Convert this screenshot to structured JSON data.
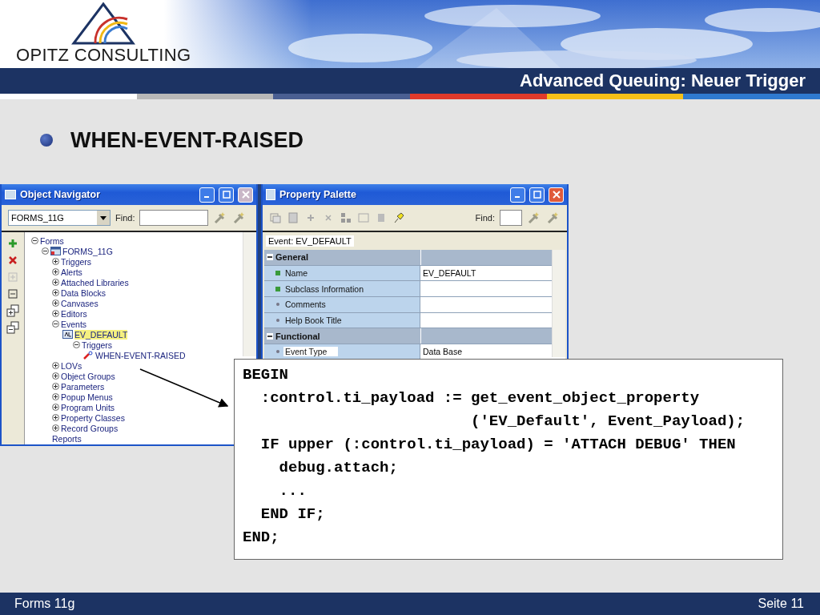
{
  "header": {
    "logo": "OPITZ CONSULTING",
    "title": "Advanced Queuing: Neuer Trigger"
  },
  "bullet": "WHEN-EVENT-RAISED",
  "navigator": {
    "title": "Object Navigator",
    "close_disabled": true,
    "module": "FORMS_11G",
    "find_label": "Find:",
    "tree": [
      {
        "label": "Forms",
        "expanded": true,
        "selected": false,
        "children": [
          {
            "label": "FORMS_11G",
            "kind": "form",
            "expanded": true,
            "selected": false,
            "children": [
              {
                "label": "Triggers",
                "expanded": false,
                "selected": false
              },
              {
                "label": "Alerts",
                "expanded": false,
                "selected": false
              },
              {
                "label": "Attached Libraries",
                "expanded": false,
                "selected": false
              },
              {
                "label": "Data Blocks",
                "expanded": false,
                "selected": false
              },
              {
                "label": "Canvases",
                "expanded": false,
                "selected": false
              },
              {
                "label": "Editors",
                "expanded": false,
                "selected": false
              },
              {
                "label": "Events",
                "expanded": true,
                "selected": false,
                "children": [
                  {
                    "label": "EV_DEFAULT",
                    "kind": "event",
                    "selected": true,
                    "children": [
                      {
                        "label": "Triggers",
                        "expanded": true,
                        "selected": false,
                        "children": [
                          {
                            "label": "WHEN-EVENT-RAISED",
                            "kind": "trigger",
                            "selected": false
                          }
                        ]
                      }
                    ]
                  }
                ]
              },
              {
                "label": "LOVs",
                "expanded": false,
                "selected": false
              },
              {
                "label": "Object Groups",
                "expanded": false,
                "selected": false
              },
              {
                "label": "Parameters",
                "expanded": false,
                "selected": false
              },
              {
                "label": "Popup Menus",
                "expanded": false,
                "selected": false
              },
              {
                "label": "Program Units",
                "expanded": false,
                "selected": false
              },
              {
                "label": "Property Classes",
                "expanded": false,
                "selected": false
              },
              {
                "label": "Record Groups",
                "expanded": false,
                "selected": false
              },
              {
                "label": "Reports",
                "selected": false
              }
            ]
          }
        ]
      }
    ]
  },
  "palette": {
    "title": "Property Palette",
    "close_disabled": false,
    "find_label": "Find:",
    "context": "Event: EV_DEFAULT",
    "rows": [
      {
        "kind": "section",
        "name": "General",
        "expanded": true
      },
      {
        "kind": "property",
        "name": "Name",
        "value": "EV_DEFAULT",
        "inherited": true,
        "selected": false
      },
      {
        "kind": "property",
        "name": "Subclass Information",
        "inherited": true,
        "selected": false
      },
      {
        "kind": "property",
        "name": "Comments",
        "inherited": false,
        "selected": false
      },
      {
        "kind": "property",
        "name": "Help Book Title",
        "inherited": false,
        "selected": false
      },
      {
        "kind": "section",
        "name": "Functional",
        "expanded": true
      },
      {
        "kind": "property",
        "name": "Event Type",
        "value": "Data Base",
        "inherited": false,
        "selected": true
      }
    ]
  },
  "code": [
    "BEGIN",
    "  :control.ti_payload := get_event_object_property",
    "                         ('EV_Default', Event_Payload);",
    "  IF upper (:control.ti_payload) = 'ATTACH DEBUG' THEN",
    "    debug.attach;",
    "    ...",
    "  END IF;",
    "END;"
  ],
  "footer": {
    "left": "Forms 11g",
    "right": "Seite 11"
  }
}
